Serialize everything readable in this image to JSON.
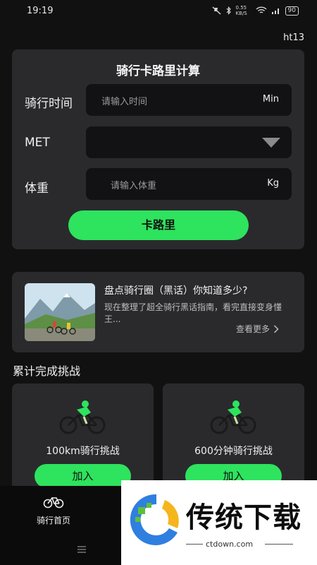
{
  "status_bar": {
    "time": "19:19",
    "network_speed": "0.55 KB/S",
    "battery": "90"
  },
  "user_id": "ht13",
  "calculator": {
    "title": "骑行卡路里计算",
    "time_label": "骑行时间",
    "time_placeholder": "请输入时间",
    "time_unit": "Min",
    "met_label": "MET",
    "weight_label": "体重",
    "weight_placeholder": "请输入体重",
    "weight_unit": "Kg",
    "button": "卡路里"
  },
  "article": {
    "title": "盘点骑行圈（黑话）你知道多少?",
    "excerpt": "现在整理了超全骑行黑话指南，看完直接变身懂王...",
    "more": "查看更多"
  },
  "section_title": "累计完成挑战",
  "challenges": [
    {
      "label": "100km骑行挑战",
      "button": "加入"
    },
    {
      "label": "600分钟骑行挑战",
      "button": "加入"
    }
  ],
  "nav": {
    "home": "骑行首页"
  },
  "watermark": {
    "text": "传统下载",
    "url": "ctdown.com"
  },
  "colors": {
    "accent": "#2ee35e",
    "card": "#2a2a2d",
    "background": "#111112",
    "input": "#121214"
  }
}
